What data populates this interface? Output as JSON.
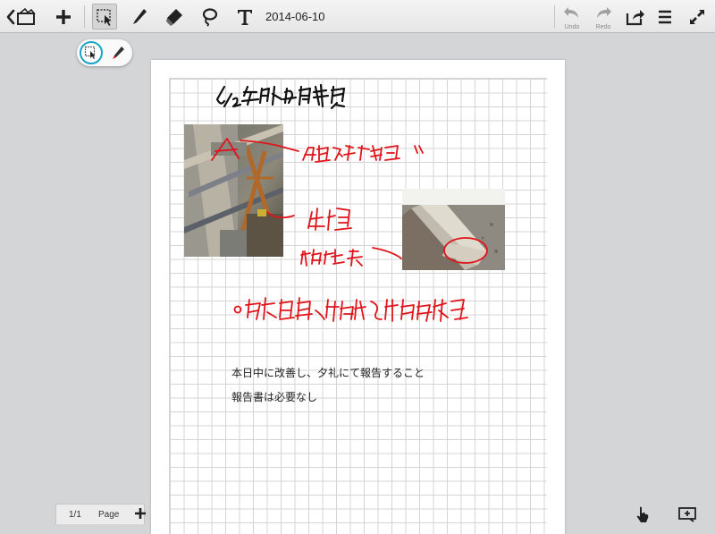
{
  "toolbar": {
    "date": "2014-06-10",
    "undo_label": "Undo",
    "redo_label": "Redo"
  },
  "note": {
    "typed_lines": [
      "本日中に改善し、夕礼にて報告すること",
      "報告書は必要なし"
    ]
  },
  "footer": {
    "page_index": "1/1",
    "page_label": "Page"
  },
  "colors": {
    "ink_black": "#111111",
    "ink_red": "#e0141b",
    "accent": "#19a4c8"
  }
}
